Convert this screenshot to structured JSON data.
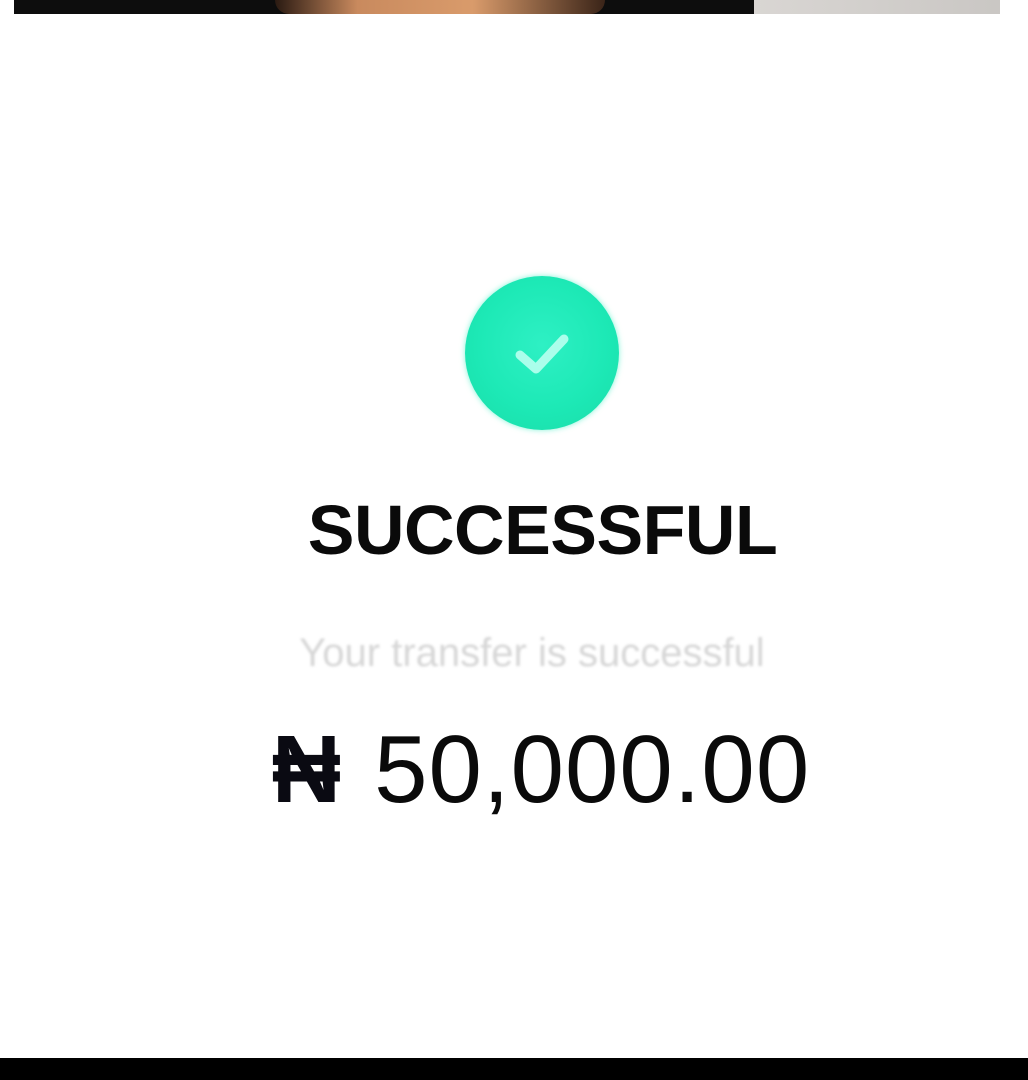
{
  "status": {
    "title": "SUCCESSFUL",
    "message": "Your transfer is successful",
    "icon": "check-circle-icon",
    "accent_color": "#1de9b6"
  },
  "transaction": {
    "currency_symbol": "₦",
    "amount": "50,000.00"
  }
}
